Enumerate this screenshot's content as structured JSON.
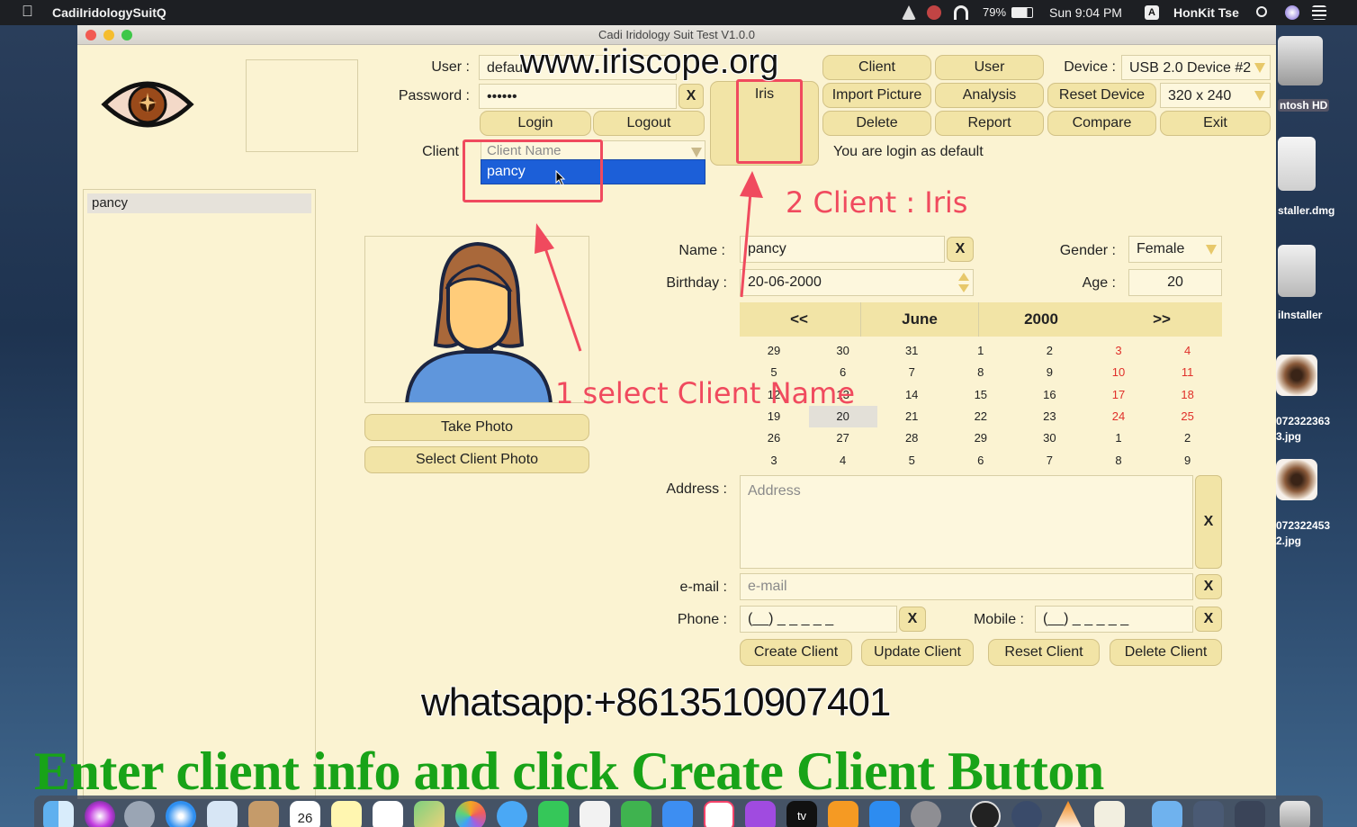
{
  "menubar": {
    "app_name": "CadiIridologySuitQ",
    "battery": "79%",
    "clock": "Sun 9:04 PM",
    "user": "HonKit Tse"
  },
  "desktop": {
    "icons": [
      {
        "label": "ntosh HD"
      },
      {
        "label": "staller.dmg"
      },
      {
        "label": "iInstaller"
      },
      {
        "label": "072322363\n3.jpg"
      },
      {
        "label": "072322453\n2.jpg"
      }
    ]
  },
  "window": {
    "title": "Cadi Iridology Suit Test V1.0.0"
  },
  "login": {
    "user_label": "User :",
    "user_value": "defau",
    "password_label": "Password :",
    "password_value": "••••••",
    "clear_label": "X",
    "login_label": "Login",
    "logout_label": "Logout",
    "client_label": "Client",
    "client_placeholder": "Client Name",
    "client_option": "pancy",
    "status": "You are login as default"
  },
  "toolbar": {
    "iris": "Iris",
    "client": "Client",
    "user": "User",
    "import_picture": "Import Picture",
    "analysis": "Analysis",
    "reset_device": "Reset Device",
    "delete": "Delete",
    "report": "Report",
    "compare": "Compare",
    "exit": "Exit",
    "device_label": "Device :",
    "device_value": "USB 2.0 Device #2",
    "resolution_value": "320 x 240"
  },
  "client_list": {
    "items": [
      "pancy"
    ]
  },
  "photo": {
    "take_photo": "Take Photo",
    "select_photo": "Select Client Photo"
  },
  "form": {
    "name_label": "Name :",
    "name_value": "pancy",
    "birthday_label": "Birthday :",
    "birthday_value": "20-06-2000",
    "gender_label": "Gender :",
    "gender_value": "Female",
    "age_label": "Age :",
    "age_value": "20",
    "address_label": "Address :",
    "address_placeholder": "Address",
    "email_label": "e-mail  :",
    "email_placeholder": "e-mail",
    "phone_label": "Phone  :",
    "phone_value": "(__) _ _ _ _ _",
    "mobile_label": "Mobile  :",
    "mobile_value": "(__) _ _ _ _ _",
    "clear": "X"
  },
  "calendar": {
    "prev": "<<",
    "month": "June",
    "year": "2000",
    "next": ">>",
    "rows": [
      [
        "29",
        "30",
        "31",
        "1",
        "2",
        "3",
        "4"
      ],
      [
        "5",
        "6",
        "7",
        "8",
        "9",
        "10",
        "11"
      ],
      [
        "12",
        "13",
        "14",
        "15",
        "16",
        "17",
        "18"
      ],
      [
        "19",
        "20",
        "21",
        "22",
        "23",
        "24",
        "25"
      ],
      [
        "26",
        "27",
        "28",
        "29",
        "30",
        "1",
        "2"
      ],
      [
        "3",
        "4",
        "5",
        "6",
        "7",
        "8",
        "9"
      ]
    ],
    "selected": "20"
  },
  "actions": {
    "create": "Create Client",
    "update": "Update Client",
    "reset": "Reset Client",
    "delete": "Delete Client"
  },
  "overlay": {
    "website": "www.iriscope.org",
    "step1": "1 select Client Name",
    "step2": "2 Client : Iris",
    "whatsapp": "whatsapp:+8613510907401",
    "caption": "Enter client info and click Create Client Button",
    "accent": "#f04a5e",
    "caption_color": "#18a318"
  },
  "dock": {
    "calendar_day": "26",
    "tv_label": "tv"
  }
}
